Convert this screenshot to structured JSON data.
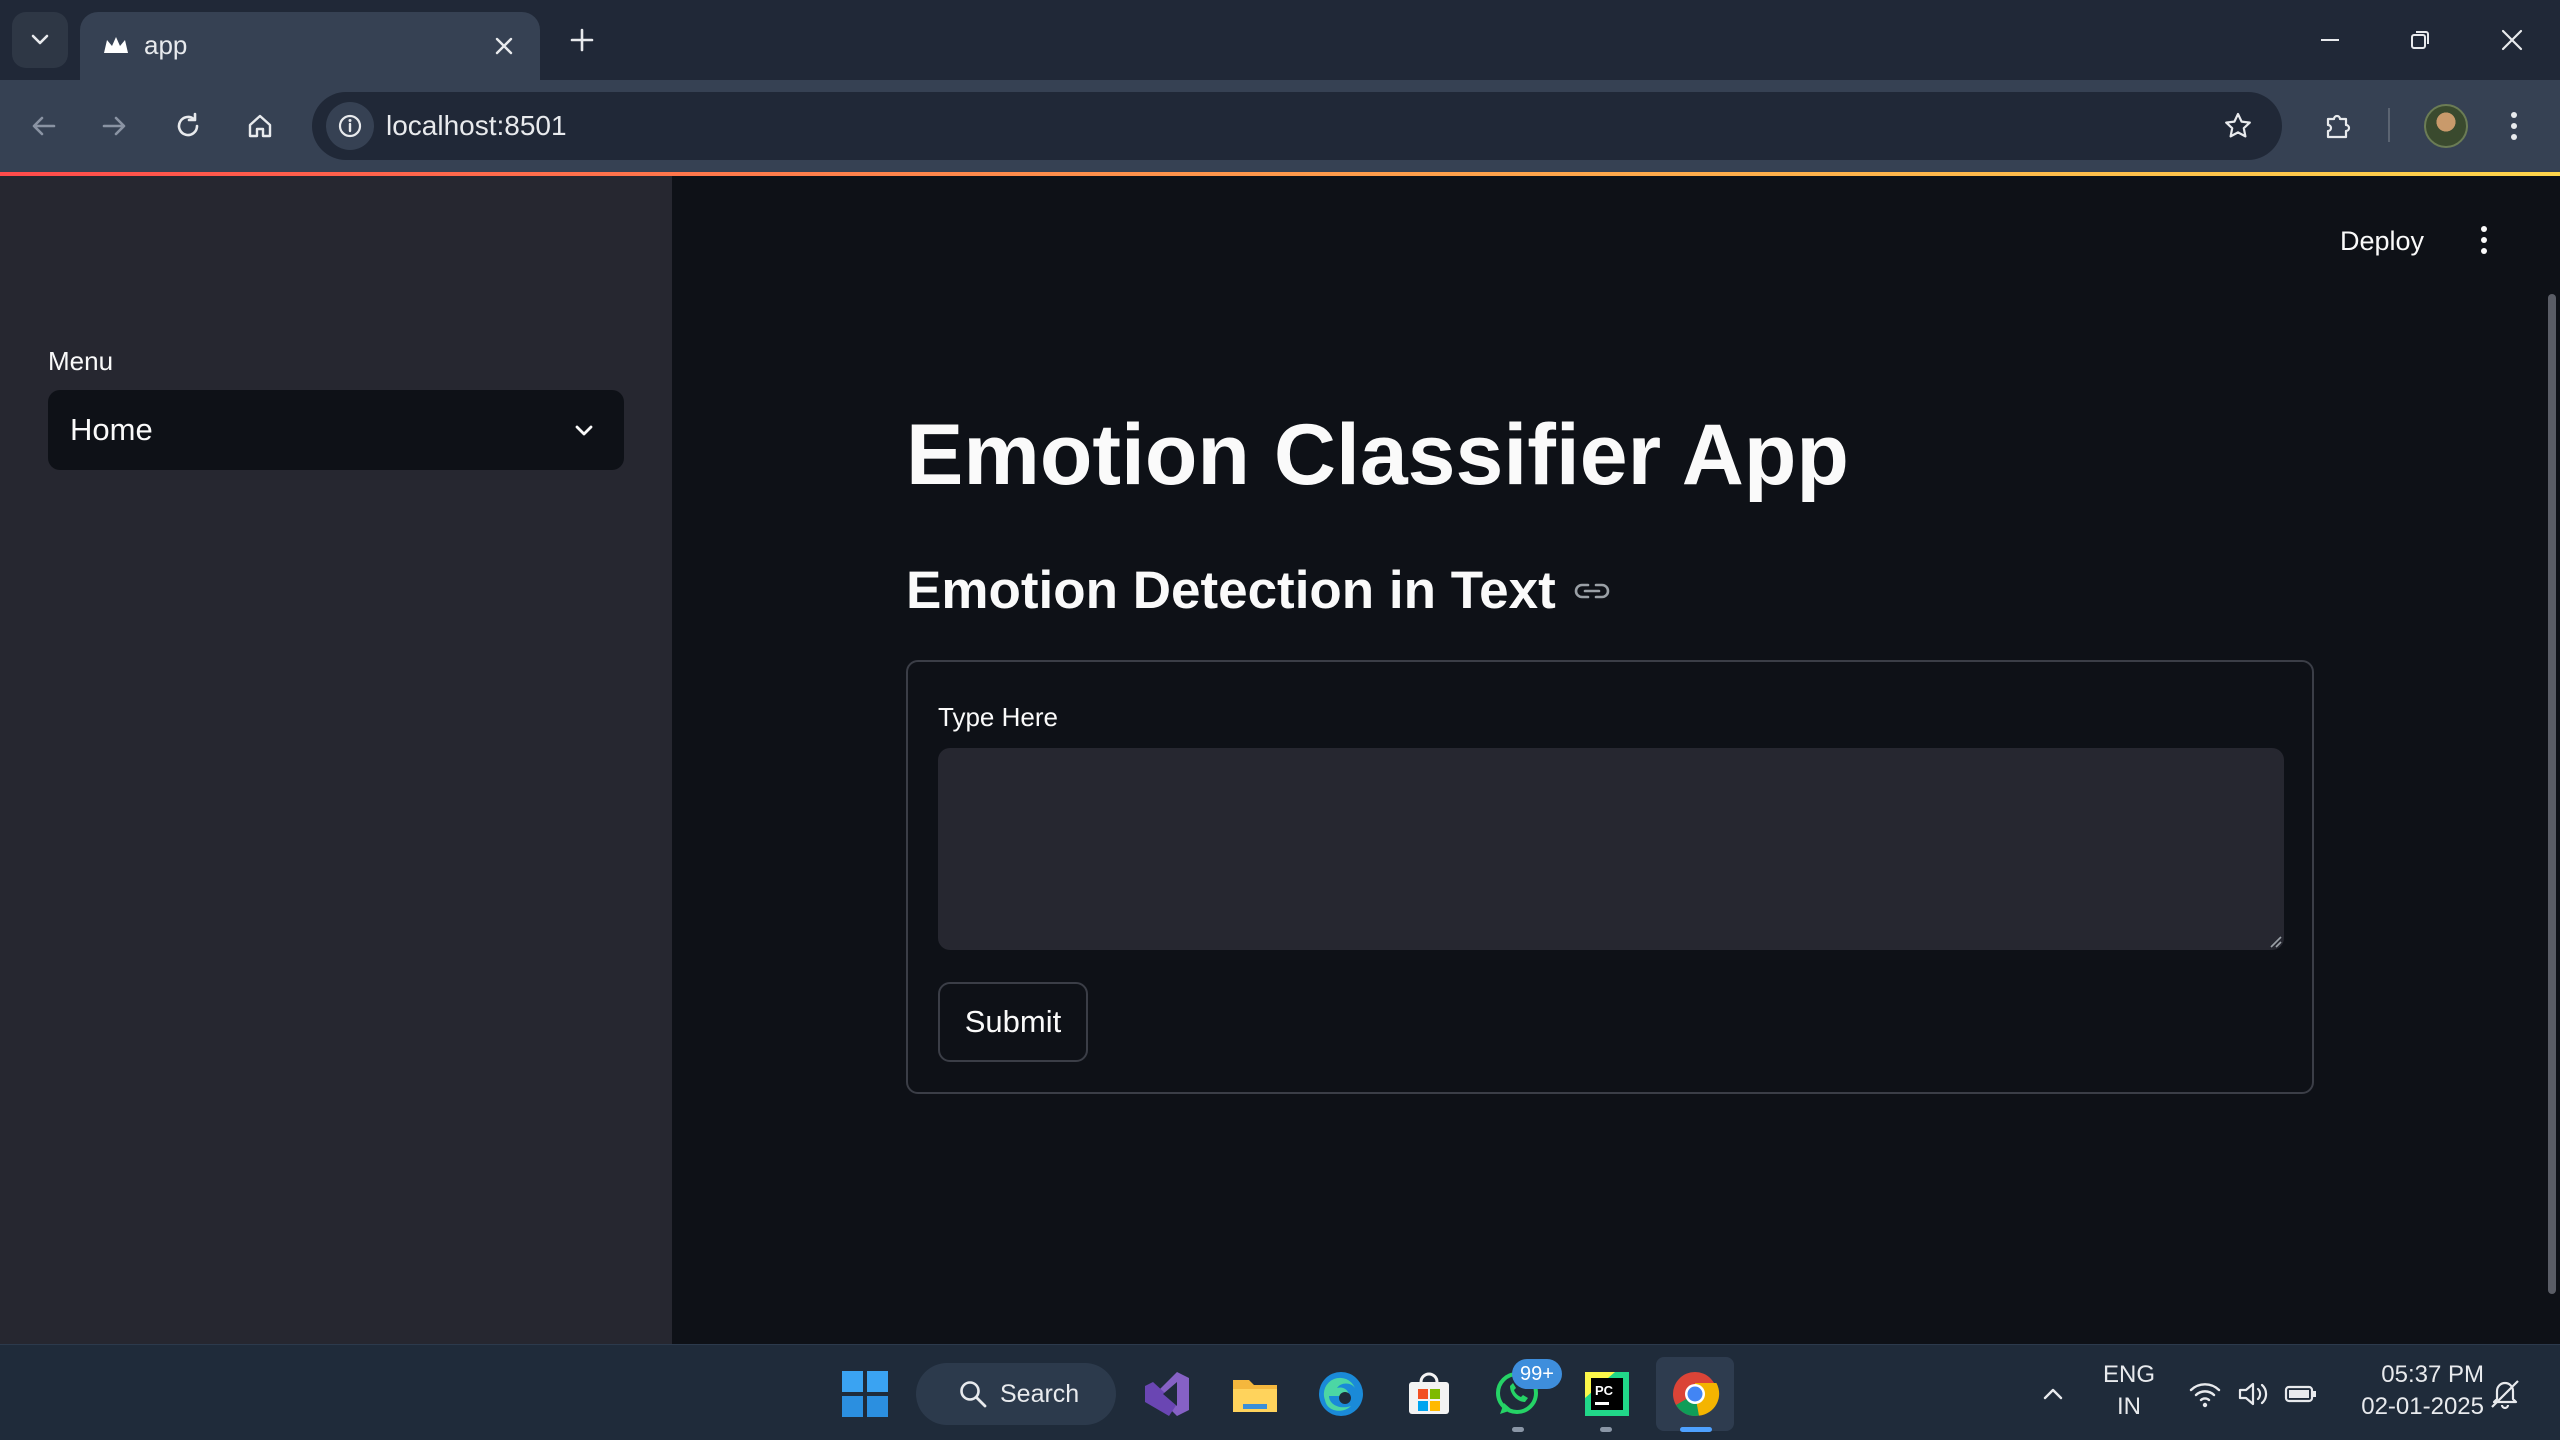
{
  "browser": {
    "tab_title": "app",
    "url": "localhost:8501"
  },
  "sidebar": {
    "menu_label": "Menu",
    "menu_selected": "Home"
  },
  "header": {
    "deploy_label": "Deploy"
  },
  "main": {
    "title": "Emotion Classifier App",
    "subheader": "Emotion Detection in Text",
    "form": {
      "field_label": "Type Here",
      "field_value": "",
      "submit_label": "Submit"
    }
  },
  "taskbar": {
    "search_label": "Search",
    "whatsapp_badge": "99+",
    "language": "ENG",
    "region": "IN",
    "time": "05:37 PM",
    "date": "02-01-2025"
  },
  "colors": {
    "app_background": "#0e1117",
    "sidebar_background": "#262730",
    "accent": "#ff4b4b"
  }
}
